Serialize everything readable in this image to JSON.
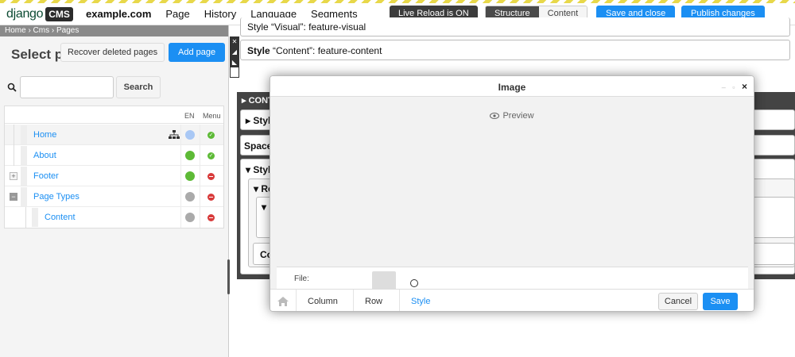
{
  "toolbar": {
    "logo_text": "django",
    "logo_badge": "CMS",
    "site": "example.com",
    "menu": [
      "Page",
      "History",
      "Language",
      "Segments"
    ],
    "live_reload": "Live Reload is ON",
    "structure": "Structure",
    "content": "Content",
    "save_close": "Save and close",
    "publish": "Publish changes"
  },
  "sidebar": {
    "breadcrumb": "Home › Cms › Pages",
    "title": "Select p",
    "recover": "Recover deleted pages",
    "add_page": "Add page",
    "search_button": "Search",
    "search_value": "",
    "columns": {
      "lang": "EN",
      "menu": "Menu"
    },
    "pages": [
      {
        "title": "Home",
        "status": "unpublished-changes",
        "in_menu": true
      },
      {
        "title": "About",
        "status": "published",
        "in_menu": true
      },
      {
        "title": "Footer",
        "status": "published",
        "in_menu": false
      },
      {
        "title": "Page Types",
        "status": "unpublished",
        "in_menu": false
      },
      {
        "title": "Content",
        "status": "unpublished",
        "in_menu": false
      }
    ],
    "colors": {
      "published": "#5dba36",
      "unpublished": "#aaaaaa",
      "unpublished-changes": "#a9c8f5"
    }
  },
  "structure": {
    "plugin1": "Style “Visual”: feature-visual",
    "plugin2_label": "Style",
    "plugin2_name": " “Content”: feature-content",
    "container_label": "CONT",
    "style1": "Styl",
    "spacer": "Space",
    "style2": "Styl",
    "row": "Ro",
    "col": "Co"
  },
  "modal": {
    "title": "Image",
    "preview": "Preview",
    "file_label": "File:",
    "crumbs": [
      "Column",
      "Row",
      "Style"
    ],
    "cancel": "Cancel",
    "save": "Save"
  }
}
